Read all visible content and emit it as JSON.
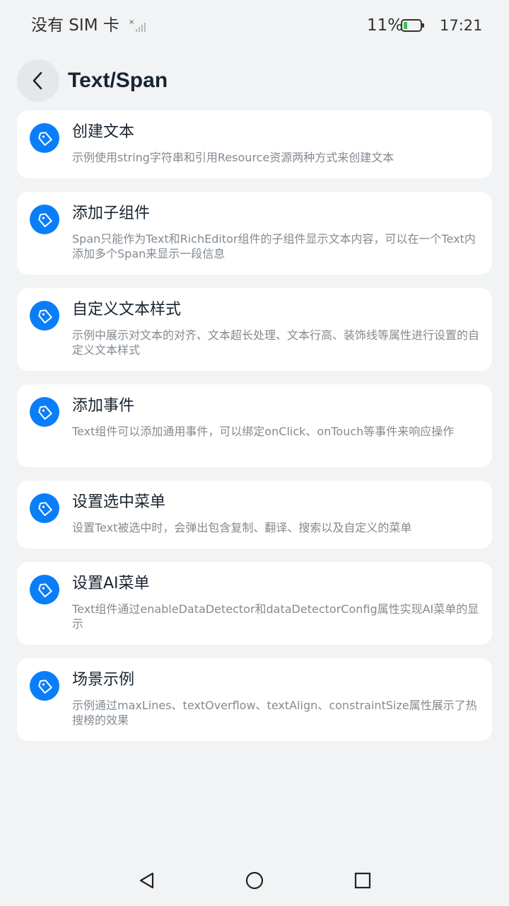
{
  "status_bar": {
    "carrier": "没有 SIM 卡",
    "battery_percent": "11%",
    "time": "17:21"
  },
  "header": {
    "title": "Text/Span",
    "back_icon": "chevron-left-icon"
  },
  "items": [
    {
      "title": "创建文本",
      "description": "示例使用string字符串和引用Resource资源两种方式来创建文本",
      "icon": "tag-icon"
    },
    {
      "title": "添加子组件",
      "description": "Span只能作为Text和RichEditor组件的子组件显示文本内容，可以在一个Text内添加多个Span来显示一段信息",
      "icon": "tag-icon"
    },
    {
      "title": "自定义文本样式",
      "description": "示例中展示对文本的对齐、文本超长处理、文本行高、装饰线等属性进行设置的自定义文本样式",
      "icon": "tag-icon"
    },
    {
      "title": "添加事件",
      "description": "Text组件可以添加通用事件，可以绑定onClick、onTouch等事件来响应操作",
      "icon": "tag-icon"
    },
    {
      "title": "设置选中菜单",
      "description": "设置Text被选中时，会弹出包含复制、翻译、搜索以及自定义的菜单",
      "icon": "tag-icon"
    },
    {
      "title": "设置AI菜单",
      "description": "Text组件通过enableDataDetector和dataDetectorConfig属性实现AI菜单的显示",
      "icon": "tag-icon"
    },
    {
      "title": "场景示例",
      "description": "示例通过maxLines、textOverflow、textAlign、constraintSize属性展示了热搜榜的效果",
      "icon": "tag-icon"
    }
  ],
  "colors": {
    "accent": "#0a7ef8",
    "background": "#f1f3f5",
    "card": "#ffffff",
    "title_text": "#182431",
    "secondary_text": "#838a92",
    "battery_low": "#3dc14a"
  },
  "nav_bar": {
    "back_icon": "triangle-back-icon",
    "home_icon": "circle-home-icon",
    "recents_icon": "square-recents-icon"
  }
}
